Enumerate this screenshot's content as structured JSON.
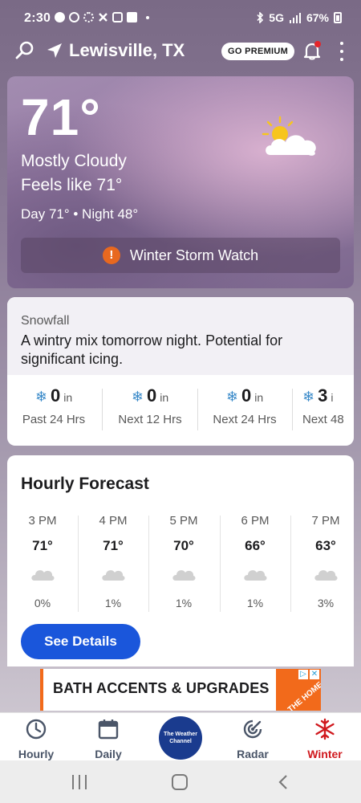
{
  "status_bar": {
    "time": "2:30",
    "network": "5G",
    "battery": "67%",
    "app_icons": [
      "account-icon",
      "sync-icon",
      "loading-icon",
      "puzzle-icon",
      "instagram-icon",
      "linkedin-icon"
    ]
  },
  "header": {
    "location": "Lewisville, TX",
    "premium_label": "GO PREMIUM"
  },
  "current": {
    "temperature": "71°",
    "condition": "Mostly Cloudy",
    "feels_like": "Feels like 71°",
    "day_night": "Day 71° • Night 48°",
    "icon": "partly-cloudy-icon",
    "alert": "Winter Storm Watch"
  },
  "snowfall": {
    "title": "Snowfall",
    "description": "A wintry mix tomorrow night. Potential for significant icing.",
    "columns": [
      {
        "amount": "0",
        "unit": "in",
        "label": "Past 24 Hrs"
      },
      {
        "amount": "0",
        "unit": "in",
        "label": "Next 12 Hrs"
      },
      {
        "amount": "0",
        "unit": "in",
        "label": "Next 24 Hrs"
      },
      {
        "amount": "3",
        "unit": "i",
        "label": "Next 48"
      }
    ]
  },
  "hourly": {
    "title": "Hourly Forecast",
    "hours": [
      {
        "time": "3 PM",
        "temp": "71°",
        "precip": "0%",
        "icon": "cloud-icon"
      },
      {
        "time": "4 PM",
        "temp": "71°",
        "precip": "1%",
        "icon": "cloud-icon"
      },
      {
        "time": "5 PM",
        "temp": "70°",
        "precip": "1%",
        "icon": "cloud-icon"
      },
      {
        "time": "6 PM",
        "temp": "66°",
        "precip": "1%",
        "icon": "cloud-icon"
      },
      {
        "time": "7 PM",
        "temp": "63°",
        "precip": "3%",
        "icon": "cloud-icon"
      }
    ],
    "details_label": "See Details"
  },
  "ad": {
    "text": "BATH ACCENTS & UPGRADES",
    "logo_text": "THE HOME DEPOT"
  },
  "bottom_nav": {
    "hourly": "Hourly",
    "daily": "Daily",
    "logo": "The Weather Channel",
    "radar": "Radar",
    "winter": "Winter"
  },
  "colors": {
    "accent_blue": "#1a56db",
    "alert_orange": "#e8681f",
    "winter_red": "#d0191e",
    "snow_blue": "#3a8ac9"
  }
}
